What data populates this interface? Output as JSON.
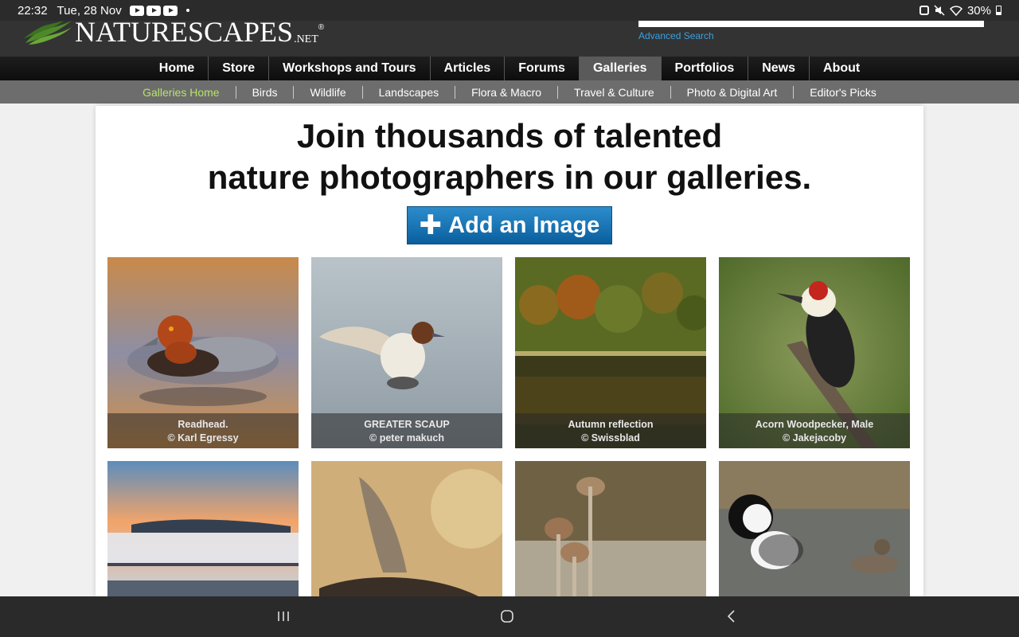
{
  "status": {
    "time": "22:32",
    "date": "Tue, 28 Nov",
    "battery": "30%"
  },
  "header": {
    "logo_main": "NATURESCAPES",
    "logo_net": ".NET",
    "logo_reg": "®",
    "advanced_search": "Advanced Search"
  },
  "main_nav": [
    {
      "label": "Home"
    },
    {
      "label": "Store"
    },
    {
      "label": "Workshops and Tours"
    },
    {
      "label": "Articles"
    },
    {
      "label": "Forums"
    },
    {
      "label": "Galleries",
      "active": true
    },
    {
      "label": "Portfolios"
    },
    {
      "label": "News"
    },
    {
      "label": "About"
    }
  ],
  "sub_nav": [
    {
      "label": "Galleries Home",
      "active": true
    },
    {
      "label": "Birds"
    },
    {
      "label": "Wildlife"
    },
    {
      "label": "Landscapes"
    },
    {
      "label": "Flora & Macro"
    },
    {
      "label": "Travel & Culture"
    },
    {
      "label": "Photo & Digital Art"
    },
    {
      "label": "Editor's Picks"
    }
  ],
  "hero": {
    "line1": "Join thousands of talented",
    "line2": "nature photographers in our galleries.",
    "add_button": "Add an Image"
  },
  "gallery": [
    {
      "title": "Readhead.",
      "credit": "© Karl Egressy",
      "image": "redhead-duck"
    },
    {
      "title": "GREATER SCAUP",
      "credit": "© peter makuch",
      "image": "scaup-duck"
    },
    {
      "title": "Autumn reflection",
      "credit": "© Swissblad",
      "image": "autumn-forest"
    },
    {
      "title": "Acorn Woodpecker, Male",
      "credit": "© Jakejacoby",
      "image": "woodpecker"
    },
    {
      "title": "",
      "credit": "",
      "image": "foggy-sunset"
    },
    {
      "title": "",
      "credit": "",
      "image": "cormorant-flight"
    },
    {
      "title": "",
      "credit": "",
      "image": "mushrooms"
    },
    {
      "title": "",
      "credit": "",
      "image": "hooded-merganser"
    }
  ]
}
